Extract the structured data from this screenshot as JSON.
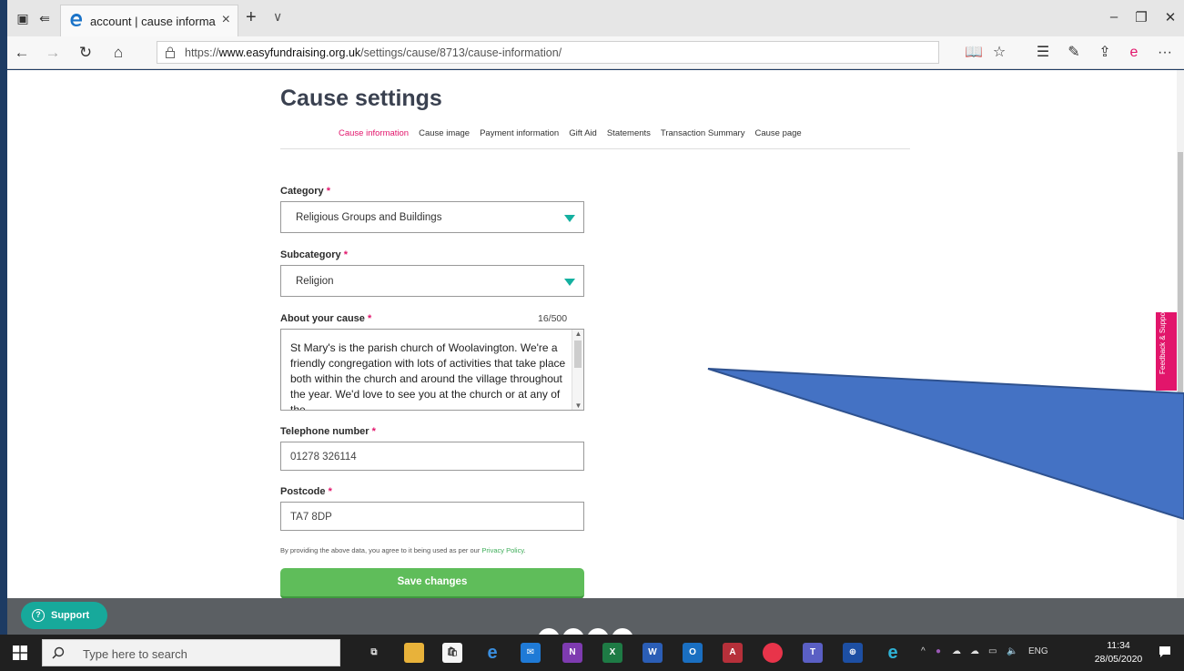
{
  "browser": {
    "tab_title": "account | cause informa",
    "tab_close": "×",
    "new_tab": "+",
    "tab_dropdown": "∨",
    "url_prefix": "https://",
    "url_domain": "www.easyfundraising.org.uk",
    "url_path": "/settings/cause/8713/cause-information/",
    "more": "···"
  },
  "page": {
    "title": "Cause settings",
    "subnav": [
      {
        "label": "Cause information",
        "active": true
      },
      {
        "label": "Cause image"
      },
      {
        "label": "Payment information"
      },
      {
        "label": "Gift Aid"
      },
      {
        "label": "Statements"
      },
      {
        "label": "Transaction Summary"
      },
      {
        "label": "Cause page"
      }
    ],
    "required_mark": "*",
    "category": {
      "label": "Category",
      "value": "Religious Groups and Buildings"
    },
    "subcategory": {
      "label": "Subcategory",
      "value": "Religion"
    },
    "about": {
      "label": "About your cause",
      "counter": "16/500",
      "value": "St Mary's is the parish church of Woolavington. We're a friendly congregation with lots of activities that take place both within the church and around the village throughout the year. We'd love to see you at the church or at any of the"
    },
    "telephone": {
      "label": "Telephone number",
      "value": "01278 326114"
    },
    "postcode": {
      "label": "Postcode",
      "value": "TA7 8DP"
    },
    "privacy_text": "By providing the above data, you agree to it being used as per our ",
    "privacy_link": "Privacy Policy",
    "privacy_end": ".",
    "save_label": "Save changes",
    "feedback_label": "Feedback & Support",
    "support_label": "Support"
  },
  "taskbar": {
    "search_placeholder": "Type here to search",
    "lang": "ENG",
    "time": "11:34",
    "date": "28/05/2020"
  },
  "colors": {
    "accent_pink": "#e2156b",
    "teal": "#14b0a0",
    "save_green": "#5fbd5a",
    "callout_blue": "#4472c4"
  }
}
